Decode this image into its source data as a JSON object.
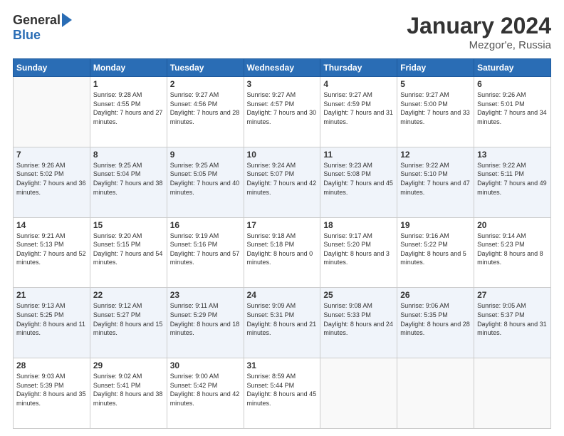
{
  "logo": {
    "general": "General",
    "blue": "Blue"
  },
  "title": "January 2024",
  "location": "Mezgor'e, Russia",
  "weekdays": [
    "Sunday",
    "Monday",
    "Tuesday",
    "Wednesday",
    "Thursday",
    "Friday",
    "Saturday"
  ],
  "weeks": [
    [
      {
        "day": "",
        "sunrise": "",
        "sunset": "",
        "daylight": ""
      },
      {
        "day": "1",
        "sunrise": "Sunrise: 9:28 AM",
        "sunset": "Sunset: 4:55 PM",
        "daylight": "Daylight: 7 hours and 27 minutes."
      },
      {
        "day": "2",
        "sunrise": "Sunrise: 9:27 AM",
        "sunset": "Sunset: 4:56 PM",
        "daylight": "Daylight: 7 hours and 28 minutes."
      },
      {
        "day": "3",
        "sunrise": "Sunrise: 9:27 AM",
        "sunset": "Sunset: 4:57 PM",
        "daylight": "Daylight: 7 hours and 30 minutes."
      },
      {
        "day": "4",
        "sunrise": "Sunrise: 9:27 AM",
        "sunset": "Sunset: 4:59 PM",
        "daylight": "Daylight: 7 hours and 31 minutes."
      },
      {
        "day": "5",
        "sunrise": "Sunrise: 9:27 AM",
        "sunset": "Sunset: 5:00 PM",
        "daylight": "Daylight: 7 hours and 33 minutes."
      },
      {
        "day": "6",
        "sunrise": "Sunrise: 9:26 AM",
        "sunset": "Sunset: 5:01 PM",
        "daylight": "Daylight: 7 hours and 34 minutes."
      }
    ],
    [
      {
        "day": "7",
        "sunrise": "Sunrise: 9:26 AM",
        "sunset": "Sunset: 5:02 PM",
        "daylight": "Daylight: 7 hours and 36 minutes."
      },
      {
        "day": "8",
        "sunrise": "Sunrise: 9:25 AM",
        "sunset": "Sunset: 5:04 PM",
        "daylight": "Daylight: 7 hours and 38 minutes."
      },
      {
        "day": "9",
        "sunrise": "Sunrise: 9:25 AM",
        "sunset": "Sunset: 5:05 PM",
        "daylight": "Daylight: 7 hours and 40 minutes."
      },
      {
        "day": "10",
        "sunrise": "Sunrise: 9:24 AM",
        "sunset": "Sunset: 5:07 PM",
        "daylight": "Daylight: 7 hours and 42 minutes."
      },
      {
        "day": "11",
        "sunrise": "Sunrise: 9:23 AM",
        "sunset": "Sunset: 5:08 PM",
        "daylight": "Daylight: 7 hours and 45 minutes."
      },
      {
        "day": "12",
        "sunrise": "Sunrise: 9:22 AM",
        "sunset": "Sunset: 5:10 PM",
        "daylight": "Daylight: 7 hours and 47 minutes."
      },
      {
        "day": "13",
        "sunrise": "Sunrise: 9:22 AM",
        "sunset": "Sunset: 5:11 PM",
        "daylight": "Daylight: 7 hours and 49 minutes."
      }
    ],
    [
      {
        "day": "14",
        "sunrise": "Sunrise: 9:21 AM",
        "sunset": "Sunset: 5:13 PM",
        "daylight": "Daylight: 7 hours and 52 minutes."
      },
      {
        "day": "15",
        "sunrise": "Sunrise: 9:20 AM",
        "sunset": "Sunset: 5:15 PM",
        "daylight": "Daylight: 7 hours and 54 minutes."
      },
      {
        "day": "16",
        "sunrise": "Sunrise: 9:19 AM",
        "sunset": "Sunset: 5:16 PM",
        "daylight": "Daylight: 7 hours and 57 minutes."
      },
      {
        "day": "17",
        "sunrise": "Sunrise: 9:18 AM",
        "sunset": "Sunset: 5:18 PM",
        "daylight": "Daylight: 8 hours and 0 minutes."
      },
      {
        "day": "18",
        "sunrise": "Sunrise: 9:17 AM",
        "sunset": "Sunset: 5:20 PM",
        "daylight": "Daylight: 8 hours and 3 minutes."
      },
      {
        "day": "19",
        "sunrise": "Sunrise: 9:16 AM",
        "sunset": "Sunset: 5:22 PM",
        "daylight": "Daylight: 8 hours and 5 minutes."
      },
      {
        "day": "20",
        "sunrise": "Sunrise: 9:14 AM",
        "sunset": "Sunset: 5:23 PM",
        "daylight": "Daylight: 8 hours and 8 minutes."
      }
    ],
    [
      {
        "day": "21",
        "sunrise": "Sunrise: 9:13 AM",
        "sunset": "Sunset: 5:25 PM",
        "daylight": "Daylight: 8 hours and 11 minutes."
      },
      {
        "day": "22",
        "sunrise": "Sunrise: 9:12 AM",
        "sunset": "Sunset: 5:27 PM",
        "daylight": "Daylight: 8 hours and 15 minutes."
      },
      {
        "day": "23",
        "sunrise": "Sunrise: 9:11 AM",
        "sunset": "Sunset: 5:29 PM",
        "daylight": "Daylight: 8 hours and 18 minutes."
      },
      {
        "day": "24",
        "sunrise": "Sunrise: 9:09 AM",
        "sunset": "Sunset: 5:31 PM",
        "daylight": "Daylight: 8 hours and 21 minutes."
      },
      {
        "day": "25",
        "sunrise": "Sunrise: 9:08 AM",
        "sunset": "Sunset: 5:33 PM",
        "daylight": "Daylight: 8 hours and 24 minutes."
      },
      {
        "day": "26",
        "sunrise": "Sunrise: 9:06 AM",
        "sunset": "Sunset: 5:35 PM",
        "daylight": "Daylight: 8 hours and 28 minutes."
      },
      {
        "day": "27",
        "sunrise": "Sunrise: 9:05 AM",
        "sunset": "Sunset: 5:37 PM",
        "daylight": "Daylight: 8 hours and 31 minutes."
      }
    ],
    [
      {
        "day": "28",
        "sunrise": "Sunrise: 9:03 AM",
        "sunset": "Sunset: 5:39 PM",
        "daylight": "Daylight: 8 hours and 35 minutes."
      },
      {
        "day": "29",
        "sunrise": "Sunrise: 9:02 AM",
        "sunset": "Sunset: 5:41 PM",
        "daylight": "Daylight: 8 hours and 38 minutes."
      },
      {
        "day": "30",
        "sunrise": "Sunrise: 9:00 AM",
        "sunset": "Sunset: 5:42 PM",
        "daylight": "Daylight: 8 hours and 42 minutes."
      },
      {
        "day": "31",
        "sunrise": "Sunrise: 8:59 AM",
        "sunset": "Sunset: 5:44 PM",
        "daylight": "Daylight: 8 hours and 45 minutes."
      },
      {
        "day": "",
        "sunrise": "",
        "sunset": "",
        "daylight": ""
      },
      {
        "day": "",
        "sunrise": "",
        "sunset": "",
        "daylight": ""
      },
      {
        "day": "",
        "sunrise": "",
        "sunset": "",
        "daylight": ""
      }
    ]
  ]
}
